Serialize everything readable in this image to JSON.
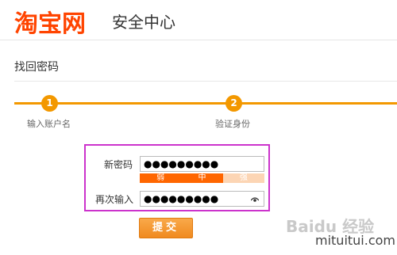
{
  "header": {
    "logo_text": "淘宝网",
    "title": "安全中心"
  },
  "page": {
    "title": "找回密码"
  },
  "steps": [
    {
      "number": "1",
      "label": "输入账户名"
    },
    {
      "number": "2",
      "label": "验证身份"
    }
  ],
  "form": {
    "new_password_label": "新密码",
    "new_password_value": "●●●●●●●●●",
    "confirm_label": "再次输入",
    "confirm_value": "●●●●●●●●●",
    "strength_levels": [
      "弱",
      "中",
      "强"
    ],
    "strength_active_levels": 2,
    "submit_label": "提交"
  },
  "watermark": {
    "logo_text": "Baidu 经验",
    "site_text": "mituitui.com"
  },
  "colors": {
    "accent": "#f39800",
    "logo": "#ff4400",
    "strength_on": "#ff6600",
    "strength_off": "#fcd5b4",
    "highlight_box": "#cc33cc"
  }
}
